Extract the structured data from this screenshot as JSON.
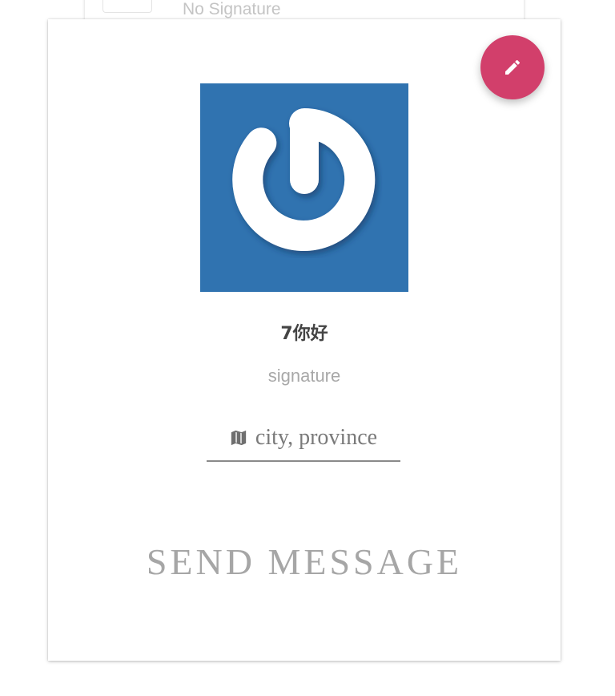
{
  "background_card": {
    "signature": "No Signature"
  },
  "profile": {
    "edit_button": {
      "icon": "pencil-icon",
      "color": "#d23f6b"
    },
    "avatar": {
      "icon": "power-logo-icon",
      "background": "#3073b0"
    },
    "username": "7你好",
    "signature": "signature",
    "location": {
      "icon": "map-icon",
      "text": "city, province"
    },
    "send_message_label": "SEND MESSAGE"
  }
}
